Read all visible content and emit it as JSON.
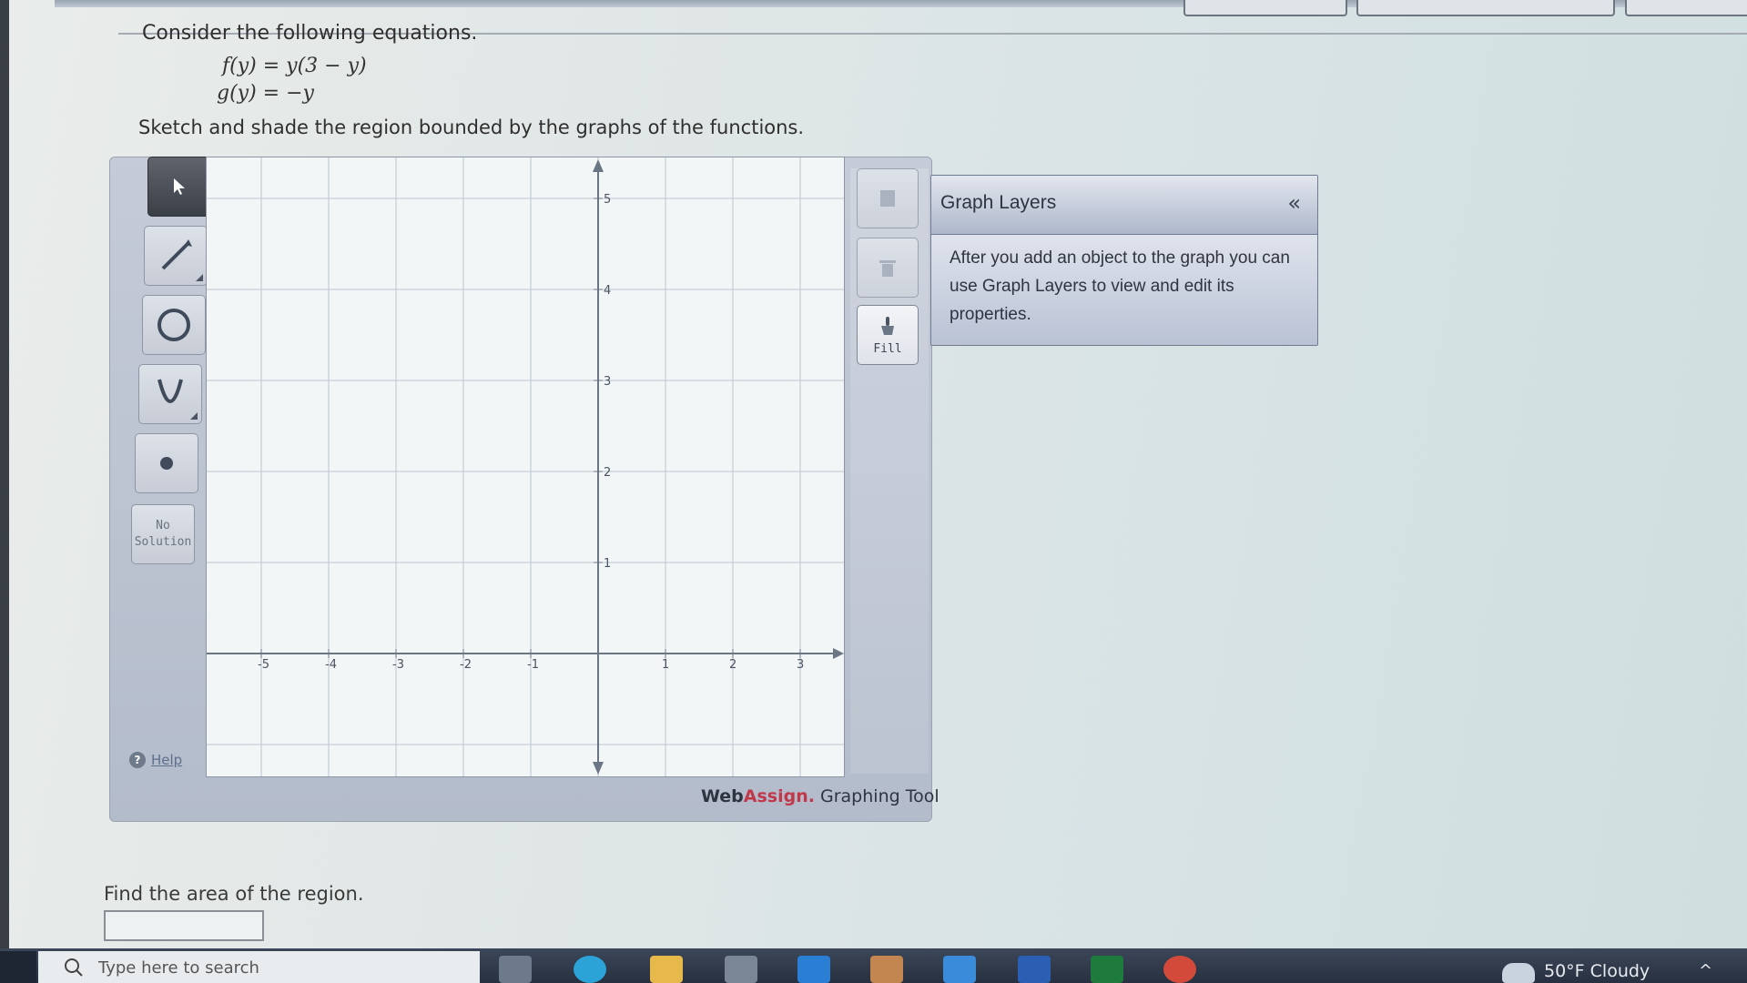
{
  "question": {
    "intro": "Consider the following equations.",
    "f_label": "f(y) = y(3 − y)",
    "g_label": "g(y) = −y",
    "instruction": "Sketch and shade the region bounded by the graphs of the functions."
  },
  "toolbar": {
    "no_solution_line1": "No",
    "no_solution_line2": "Solution",
    "help_label": "Help"
  },
  "graph": {
    "x_ticks": [
      "-5",
      "-4",
      "-3",
      "-2",
      "-1",
      "1",
      "2",
      "3"
    ],
    "y_ticks": [
      "5",
      "4",
      "3",
      "2",
      "1"
    ]
  },
  "right_tools": {
    "fill_label": "Fill"
  },
  "brand": {
    "web": "Web",
    "assign": "Assign.",
    "tool": " Graphing Tool"
  },
  "graph_layers": {
    "title": "Graph Layers",
    "collapse_glyph": "«",
    "body": "After you add an object to the graph you can use Graph Layers to view and edit its properties."
  },
  "area": {
    "question": "Find the area of the region."
  },
  "taskbar": {
    "search_placeholder": "Type here to search",
    "weather": "50°F  Cloudy"
  }
}
